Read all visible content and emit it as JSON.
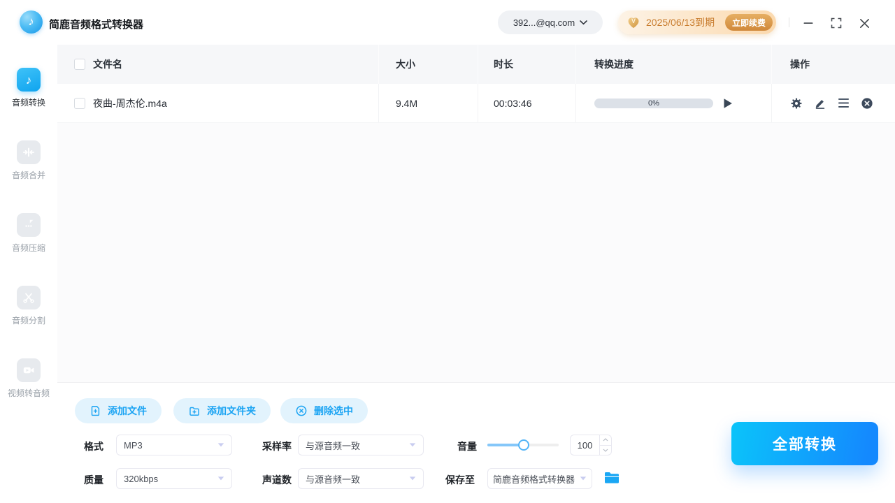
{
  "app": {
    "title": "简鹿音频格式转换器"
  },
  "topbar": {
    "account_label": "392...@qq.com",
    "vip_expiry": "2025/06/13到期",
    "vip_renew": "立即续费"
  },
  "sidebar": {
    "items": [
      {
        "label": "音频转换",
        "active": true
      },
      {
        "label": "音频合并",
        "active": false
      },
      {
        "label": "音频压缩",
        "active": false
      },
      {
        "label": "音频分割",
        "active": false
      },
      {
        "label": "视频转音频",
        "active": false
      }
    ]
  },
  "table": {
    "headers": {
      "name": "文件名",
      "size": "大小",
      "duration": "时长",
      "progress": "转换进度",
      "actions": "操作"
    },
    "rows": [
      {
        "name": "夜曲-周杰伦.m4a",
        "size": "9.4M",
        "duration": "00:03:46",
        "progress_text": "0%",
        "progress_percent": 0
      }
    ]
  },
  "toolbar": {
    "add_file": "添加文件",
    "add_folder": "添加文件夹",
    "delete_selected": "删除选中"
  },
  "settings": {
    "format_label": "格式",
    "format_value": "MP3",
    "sample_rate_label": "采样率",
    "sample_rate_value": "与源音频一致",
    "volume_label": "音量",
    "volume_value": "100",
    "quality_label": "质量",
    "quality_value": "320kbps",
    "channels_label": "声道数",
    "channels_value": "与源音频一致",
    "save_to_label": "保存至",
    "save_to_value": "简鹿音频格式转换器"
  },
  "actions": {
    "convert_all": "全部转换"
  },
  "colors": {
    "accent_blue": "#1aa7f4",
    "convert_gradient_start": "#0bc4fa",
    "convert_gradient_end": "#1489fe",
    "vip_text": "#c87c2e",
    "pill_bg": "#e2f3fd"
  }
}
